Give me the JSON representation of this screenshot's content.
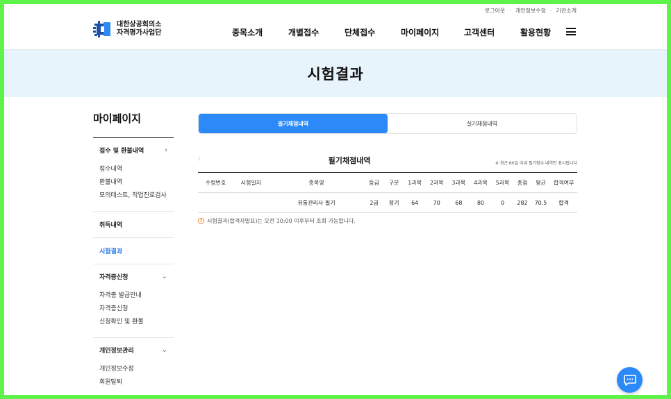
{
  "util_links": [
    "로그아웃",
    "개인정보수정",
    "기관소개"
  ],
  "logo": {
    "line1": "대한상공회의소",
    "line2": "자격평가사업단"
  },
  "gnb": [
    "종목소개",
    "개별접수",
    "단체접수",
    "마이페이지",
    "고객센터",
    "활용현황"
  ],
  "banner_title": "시험결과",
  "sidebar": {
    "title": "마이페이지",
    "groups": [
      {
        "label": "접수 및 환불내역",
        "items": [
          "접수내역",
          "환불내역",
          "모의테스트, 직업진로검사"
        ]
      },
      {
        "label": "취득내역",
        "items": []
      },
      {
        "label": "시험결과",
        "items": []
      },
      {
        "label": "자격증신청",
        "items": [
          "자격증 발급안내",
          "자격증신청",
          "신청확인 및 환불"
        ]
      },
      {
        "label": "개인정보관리",
        "items": [
          "개인정보수정",
          "회원탈퇴"
        ]
      }
    ]
  },
  "tabs": [
    "필기채점내역",
    "실기채점내역"
  ],
  "colon": ":",
  "table": {
    "title": "필기채점내역",
    "note": "※ 최근 60일 이내 필기점수 내역만 표시됩니다",
    "headers": [
      "수험번호",
      "시험일자",
      "종목명",
      "등급",
      "구분",
      "1과목",
      "2과목",
      "3과목",
      "4과목",
      "5과목",
      "총점",
      "평균",
      "합격여부"
    ],
    "rows": [
      [
        "",
        "",
        "유통관리사 필기",
        "2급",
        "정기",
        "64",
        "70",
        "68",
        "80",
        "0",
        "282",
        "70.5",
        "합격"
      ]
    ]
  },
  "info_text": "시험결과(합격자발표)는 오전 10:00 이후부터 조회 가능합니다.",
  "colors": {
    "accent": "#2b8af7",
    "banner_bg": "#e8f4fb",
    "frame": "#5ff24a"
  }
}
